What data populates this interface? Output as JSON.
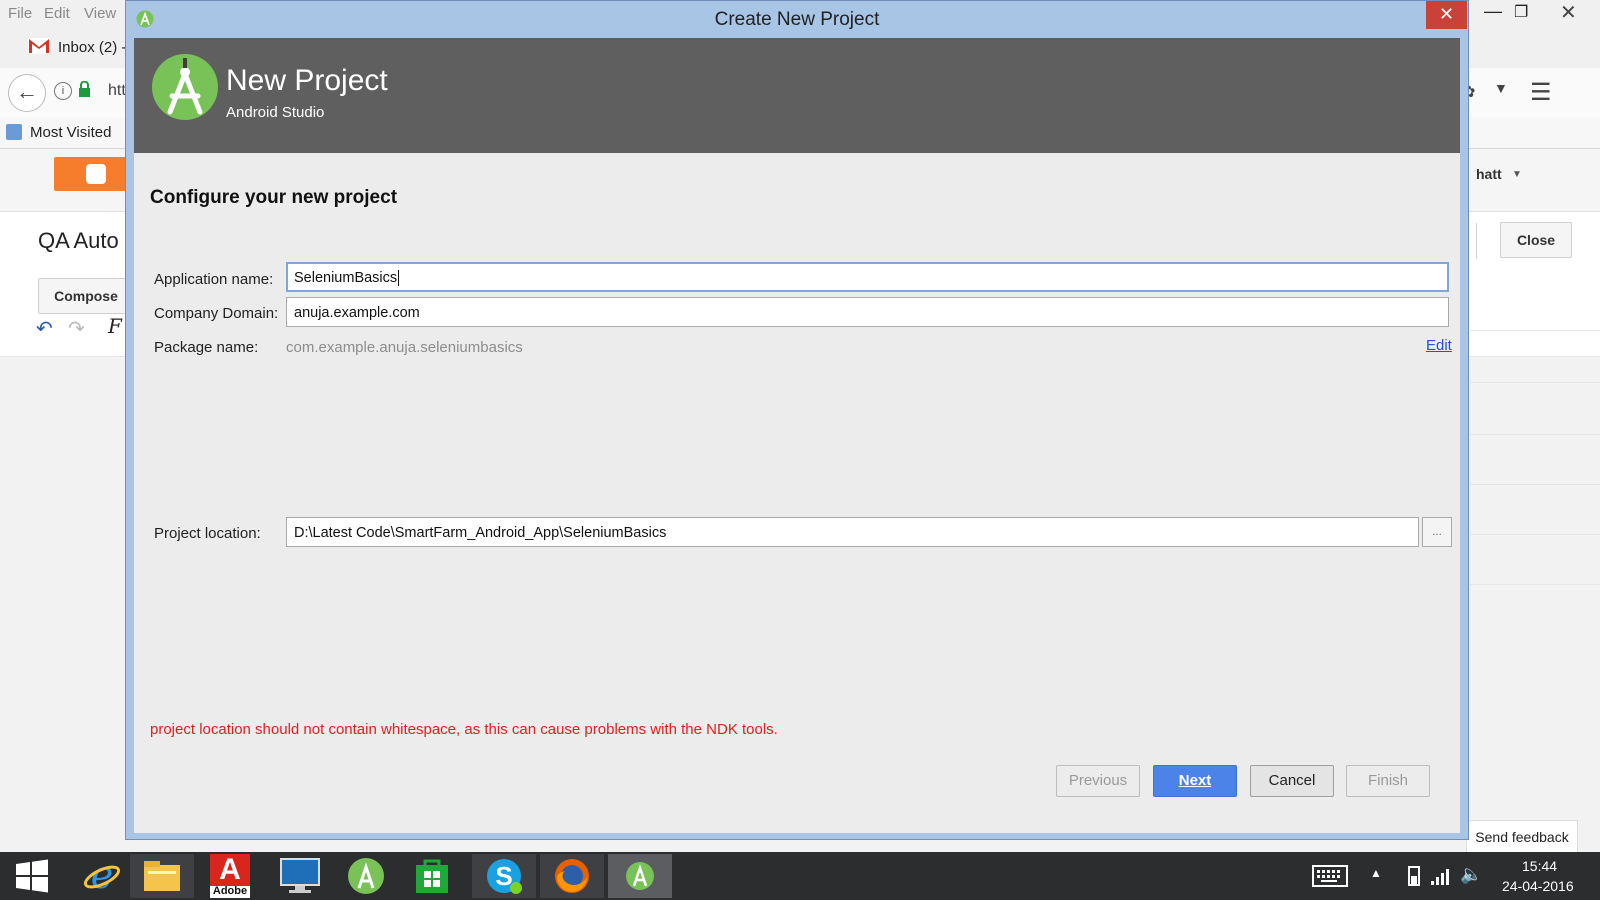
{
  "browser": {
    "menu": [
      "File",
      "Edit",
      "View"
    ],
    "tab_label": "Inbox (2) -",
    "url_partial": "htt",
    "bookmark_label": "Most Visited",
    "blog_title_partial": "QA Auto",
    "compose_label": "Compose",
    "user_partial": "hatt",
    "close_label": "Close",
    "send_feedback": "Send feedback"
  },
  "dialog": {
    "title": "Create New Project",
    "header": {
      "title": "New Project",
      "subtitle": "Android Studio"
    },
    "section_title": "Configure your new project",
    "fields": {
      "app_name_label": "Application name:",
      "app_name_value": "SeleniumBasics",
      "domain_label": "Company Domain:",
      "domain_value": "anuja.example.com",
      "package_label": "Package name:",
      "package_value": "com.example.anuja.seleniumbasics",
      "edit_label": "Edit",
      "location_label": "Project location:",
      "location_value": "D:\\Latest Code\\SmartFarm_Android_App\\SeleniumBasics",
      "browse_label": "..."
    },
    "warning": "project location should not contain whitespace, as this can cause problems with the NDK tools.",
    "buttons": {
      "previous": "Previous",
      "next": "Next",
      "cancel": "Cancel",
      "finish": "Finish"
    }
  },
  "taskbar": {
    "adobe_label": "Adobe",
    "time": "15:44",
    "date": "24-04-2016"
  },
  "colors": {
    "dialog_frame": "#a8c5e6",
    "header_bg": "#5f5f5f",
    "android_green": "#78c257",
    "primary_button": "#4b83e8",
    "warning_text": "#e02020",
    "close_red": "#c9423a"
  },
  "icons": [
    "android-studio-icon",
    "windows-start-icon",
    "ie-icon",
    "file-explorer-icon",
    "adobe-icon",
    "lenovo-icon",
    "store-icon",
    "skype-icon",
    "firefox-icon",
    "keyboard-icon",
    "battery-icon",
    "signal-icon",
    "volume-icon"
  ]
}
